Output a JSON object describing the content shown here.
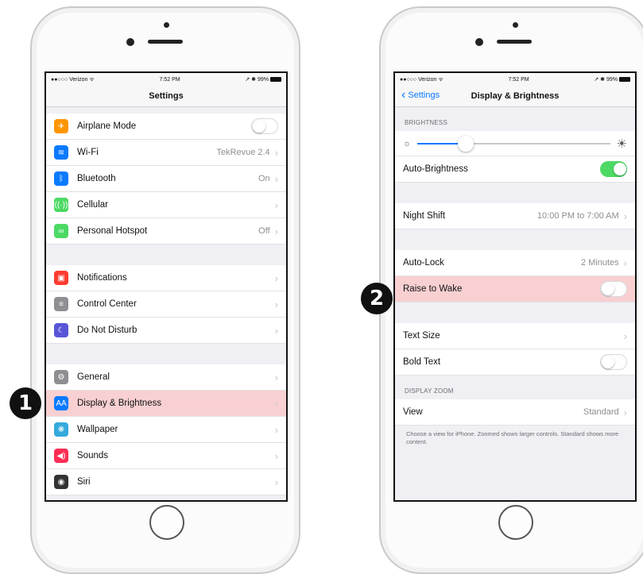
{
  "left": {
    "status": {
      "carrier": "●●○○○ Verizon ᯤ",
      "time": "7:52 PM",
      "right": "↗ ✱ 99%"
    },
    "nav_title": "Settings",
    "group1": [
      {
        "label": "Airplane Mode",
        "value": "",
        "icon": "airplane-icon",
        "glyph": "✈",
        "color": "#ff9500",
        "toggle": "off"
      },
      {
        "label": "Wi-Fi",
        "value": "TekRevue 2.4",
        "icon": "wifi-icon",
        "glyph": "≋",
        "color": "#0a7aff"
      },
      {
        "label": "Bluetooth",
        "value": "On",
        "icon": "bluetooth-icon",
        "glyph": "ᛒ",
        "color": "#0a7aff"
      },
      {
        "label": "Cellular",
        "value": "",
        "icon": "cellular-icon",
        "glyph": "((·))",
        "color": "#4cd964"
      },
      {
        "label": "Personal Hotspot",
        "value": "Off",
        "icon": "hotspot-icon",
        "glyph": "∞",
        "color": "#4cd964"
      }
    ],
    "group2": [
      {
        "label": "Notifications",
        "icon": "notifications-icon",
        "glyph": "▣",
        "color": "#ff3b30"
      },
      {
        "label": "Control Center",
        "icon": "control-center-icon",
        "glyph": "≡",
        "color": "#8e8e93"
      },
      {
        "label": "Do Not Disturb",
        "icon": "moon-icon",
        "glyph": "☾",
        "color": "#5856d6"
      }
    ],
    "group3": [
      {
        "label": "General",
        "icon": "gear-icon",
        "glyph": "⚙",
        "color": "#8e8e93"
      },
      {
        "label": "Display & Brightness",
        "icon": "display-brightness-icon",
        "glyph": "AA",
        "color": "#0a7aff"
      },
      {
        "label": "Wallpaper",
        "icon": "wallpaper-icon",
        "glyph": "❋",
        "color": "#34aadc"
      },
      {
        "label": "Sounds",
        "icon": "sounds-icon",
        "glyph": "◀)",
        "color": "#ff2d55"
      },
      {
        "label": "Siri",
        "icon": "siri-icon",
        "glyph": "◉",
        "color": "#333333"
      }
    ],
    "badge": "1"
  },
  "right": {
    "status": {
      "carrier": "●●○○○ Verizon ᯤ",
      "time": "7:52 PM",
      "right": "↗ ✱ 99%"
    },
    "back_label": "Settings",
    "nav_title": "Display & Brightness",
    "brightness_header": "BRIGHTNESS",
    "brightness_level": 0.25,
    "auto_brightness": {
      "label": "Auto-Brightness",
      "toggle": "on"
    },
    "night_shift": {
      "label": "Night Shift",
      "value": "10:00 PM to 7:00 AM"
    },
    "auto_lock": {
      "label": "Auto-Lock",
      "value": "2 Minutes"
    },
    "raise_to_wake": {
      "label": "Raise to Wake",
      "toggle": "off"
    },
    "text_size": {
      "label": "Text Size"
    },
    "bold_text": {
      "label": "Bold Text",
      "toggle": "off"
    },
    "zoom_header": "DISPLAY ZOOM",
    "view": {
      "label": "View",
      "value": "Standard"
    },
    "footnote": "Choose a view for iPhone. Zoomed shows larger controls. Standard shows more content.",
    "badge": "2"
  },
  "colors": {
    "highlight": "#f8d0d2",
    "ios_blue": "#0a7aff",
    "toggle_on": "#4cd964"
  }
}
